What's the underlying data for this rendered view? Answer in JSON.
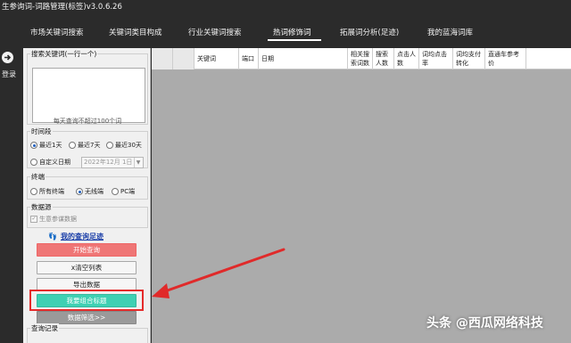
{
  "window": {
    "title": "生参询词-词路管理(标签)v3.0.6.26"
  },
  "nav": {
    "tabs": [
      {
        "label": "市场关键词搜索"
      },
      {
        "label": "关键词类目构成"
      },
      {
        "label": "行业关键词搜索"
      },
      {
        "label": "热词修饰词"
      },
      {
        "label": "拓展词分析(足迹)"
      },
      {
        "label": "我的蓝海词库"
      }
    ],
    "active_index": 3
  },
  "left_rail": {
    "login_label": "登录"
  },
  "panel": {
    "keyword_group_title": "搜索关键词(一行一个)",
    "keyword_input_value": "",
    "keyword_hint": "每天查询不超过100个词",
    "time_group_title": "时间段",
    "time_options": [
      {
        "label": "最近1天",
        "checked": true
      },
      {
        "label": "最近7天",
        "checked": false
      },
      {
        "label": "最近30天",
        "checked": false
      },
      {
        "label": "自定义日期",
        "checked": false
      }
    ],
    "date_value": "2022年12月 1日",
    "terminal_group_title": "终端",
    "terminal_options": [
      {
        "label": "所有终端",
        "checked": false
      },
      {
        "label": "无线端",
        "checked": true
      },
      {
        "label": "PC端",
        "checked": false
      }
    ],
    "source_group_title": "数据源",
    "source_checkbox_label": "生意参谋数据",
    "source_checked": true,
    "footprint_link": "我的查询足迹",
    "buttons": {
      "start": "开始查询",
      "clear": "x清空列表",
      "export": "导出数据",
      "compose": "我要组合标题",
      "filter": "数据筛选>>"
    },
    "history_title": "查询记录"
  },
  "grid": {
    "columns": [
      "",
      "",
      "关键词",
      "端口",
      "日期",
      "相关搜索词数",
      "搜索人数",
      "点击人数",
      "词均点击率",
      "词均支付转化",
      "直通车参考价"
    ]
  },
  "watermark": "头条 @西瓜网络科技",
  "colors": {
    "titlebar_bg": "#2b2b2b",
    "start_button": "#ef7676",
    "compose_button": "#3fd0b3",
    "filter_button": "#9a9a9a",
    "highlight": "#e52b2b",
    "link": "#1a3ea8",
    "grid_bg": "#ababab"
  },
  "icons": {
    "login": "arrow-right-circle-icon",
    "footprint": "footprint-icon",
    "annotation": "red-arrow-icon"
  }
}
